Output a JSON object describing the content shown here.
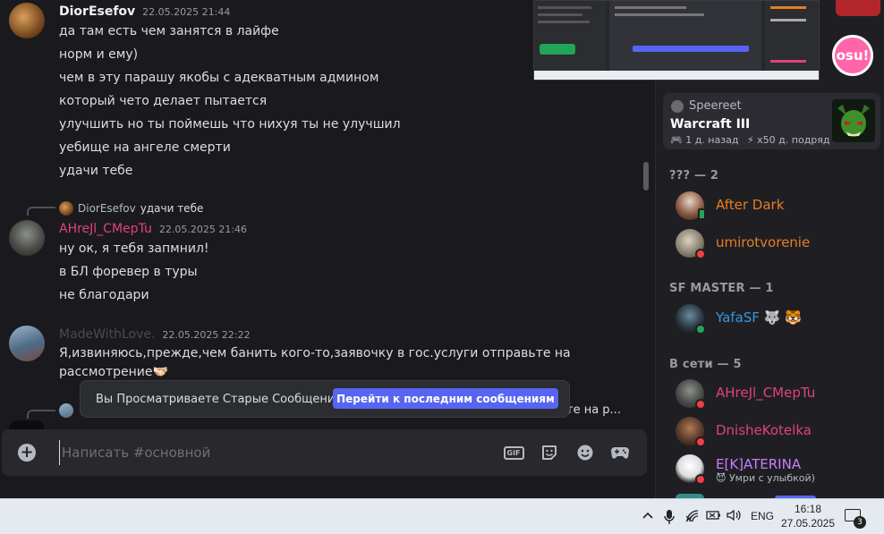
{
  "chat": {
    "messages": [
      {
        "author": "DiorEsefov",
        "author_color": "#f2f3f5",
        "timestamp": "22.05.2025 21:44",
        "lines": [
          "да там есть чем занятся в лайфе",
          "норм и ему)",
          "чем в эту парашу якобы с адекватным админом",
          "который чето делает пытается",
          "улучшить но ты поймешь что нихуя ты не улучшил",
          "уебище на ангеле смерти",
          "удачи тебе"
        ]
      },
      {
        "reply_to_author": "DiorEsefov",
        "reply_to_text": "удачи тебе",
        "author": "AHreJl_CMepTu",
        "author_color": "#e0417f",
        "timestamp": "22.05.2025 21:46",
        "lines": [
          "ну ок, я тебя запмнил!",
          "в БЛ форевер в туры",
          "не благодари"
        ]
      },
      {
        "author": "MadeWithLove.",
        "author_color": "#4a4c52",
        "timestamp": "22.05.2025 22:22",
        "lines": [
          "Я,извиняюсь,прежде,чем банить кого-то,заявочку в гос.услуги отправьте на",
          "рассмотрение🫱🏻‍🫲🏼"
        ]
      }
    ],
    "partial_reply_text": "те на р..."
  },
  "old_messages_banner": {
    "text": "Вы Просматриваете Старые Сообщения",
    "jump_label": "Перейти к последним сообщениям"
  },
  "composer": {
    "placeholder": "Написать #основной",
    "gif_label": "GIF",
    "icons": [
      "plus-icon",
      "gif-icon",
      "sticker-icon",
      "emoji-icon",
      "gamepad-icon"
    ]
  },
  "sidebar": {
    "logo_text": "osu!",
    "activity": {
      "user": "Speereet",
      "game": "Warcraft III",
      "time_ago": "1 д. назад",
      "streak": "x50 д. подряд"
    },
    "sections": [
      {
        "title": "??? — 2",
        "members": [
          {
            "name": "After Dark",
            "color": "#e67e22",
            "status": "mobile"
          },
          {
            "name": "umirotvorenie",
            "color": "#e67e22",
            "status": "dnd"
          }
        ]
      },
      {
        "title": "SF MASTER — 1",
        "members": [
          {
            "name": "YafaSF",
            "color": "#3498db",
            "status": "online",
            "badges": "🐺 🐯"
          }
        ]
      },
      {
        "title": "В сети — 5",
        "members": [
          {
            "name": "AHreJl_CMepTu",
            "color": "#e0417f",
            "status": "dnd"
          },
          {
            "name": "DnisheKotelka",
            "color": "#e0417f",
            "status": "dnd"
          },
          {
            "name": "E[K]ATERINA",
            "color": "#c77dff",
            "status": "dnd",
            "custom_status": "😈 Умри с улыбкой)"
          }
        ]
      }
    ]
  },
  "taskbar": {
    "language": "ENG",
    "time": "16:18",
    "date": "27.05.2025",
    "notification_count": "3"
  }
}
